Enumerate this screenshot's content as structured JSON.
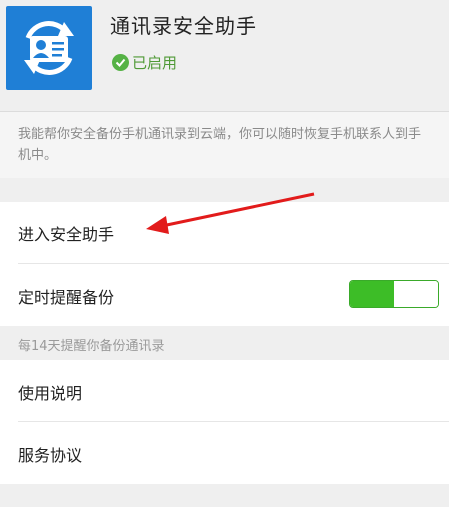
{
  "app": {
    "title": "通讯录安全助手",
    "status": "已启用",
    "description": "我能帮你安全备份手机通讯录到云端，你可以随时恢复手机联系人到手机中。"
  },
  "menu": {
    "enter_helper": "进入安全助手",
    "scheduled_backup_reminder": "定时提醒备份",
    "backup_reminder_hint": "每14天提醒你备份通讯录",
    "usage_instructions": "使用说明",
    "service_agreement": "服务协议"
  },
  "toggle": {
    "scheduled_backup_enabled": true
  },
  "colors": {
    "icon_blue": "#1f7fd6",
    "status_green": "#55b245",
    "toggle_green": "#3dbd27",
    "arrow_red": "#e21b1b"
  },
  "icons": {
    "app": "contacts-sync-icon",
    "status": "check-circle-icon"
  }
}
